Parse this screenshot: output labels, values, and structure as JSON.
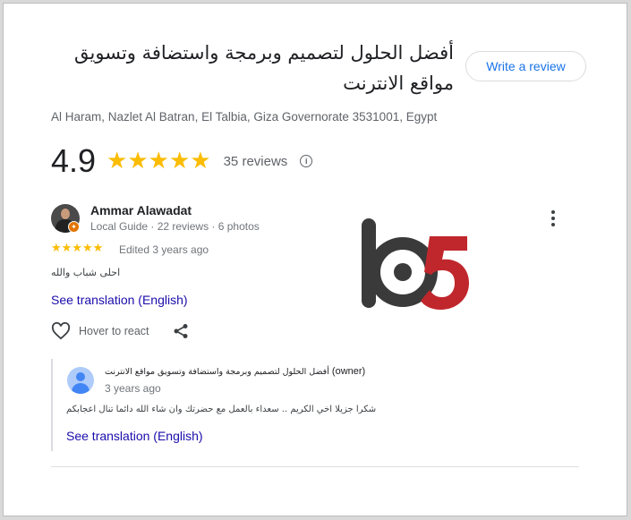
{
  "business": {
    "title": "أفضل الحلول لتصميم وبرمجة واستضافة وتسويق مواقع الانترنت",
    "address": "Al Haram, Nazlet Al Batran, El Talbia, Giza Governorate 3531001, Egypt",
    "rating": "4.9",
    "stars": "★★★★★",
    "reviews_count": "35 reviews",
    "write_review_label": "Write a review"
  },
  "review": {
    "reviewer_name": "Ammar Alawadat",
    "reviewer_meta": "Local Guide · 22 reviews · 6 photos",
    "stars": "★★★★★",
    "edited": "Edited 3 years ago",
    "text": "احلى شباب والله",
    "see_translation": "See translation (English)",
    "react_label": "Hover to react"
  },
  "owner_response": {
    "name": "أفضل الحلول لتصميم وبرمجة واستضافة وتسويق مواقع الانترنت",
    "owner_tag": "(owner)",
    "time": "3 years ago",
    "text": "شكرا جزيلا اخي الكريم .. سعداء بالعمل مع حضرتك وان شاء الله دائما تنال اعجابكم",
    "see_translation": "See translation (English)"
  },
  "colors": {
    "accent_blue": "#1a73e8",
    "link": "#1a0dab",
    "star": "#fbbc04",
    "watermark_dark": "#3a3a3a",
    "watermark_red": "#c0272d"
  },
  "icons": {
    "info": "info-icon",
    "more": "more-vert-icon",
    "heart": "heart-outline-icon",
    "share": "share-icon",
    "guide_badge": "local-guide-badge-icon"
  }
}
